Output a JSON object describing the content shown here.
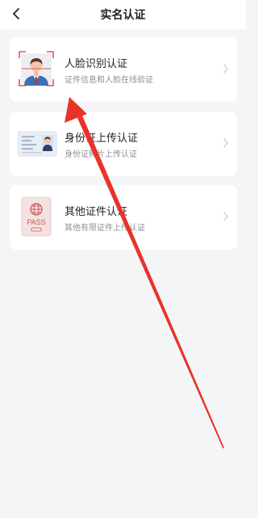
{
  "header": {
    "title": "实名认证",
    "back_icon": "chevron-left-icon"
  },
  "options": [
    {
      "label": "人脸识别认证",
      "desc": "证件信息和人脸在线验证",
      "icon": "face-scan-icon"
    },
    {
      "label": "身份证上传认证",
      "desc": "身份证照片上传认证",
      "icon": "id-card-icon"
    },
    {
      "label": "其他证件认证",
      "desc": "其他有限证件上传认证",
      "icon": "passport-icon",
      "passport_text": "PASS"
    }
  ],
  "colors": {
    "background": "#f4f5f7",
    "card": "#ffffff",
    "annotation_arrow": "#e8332a",
    "face_frame": "#e05a4e",
    "passport_red": "#c65a59"
  }
}
